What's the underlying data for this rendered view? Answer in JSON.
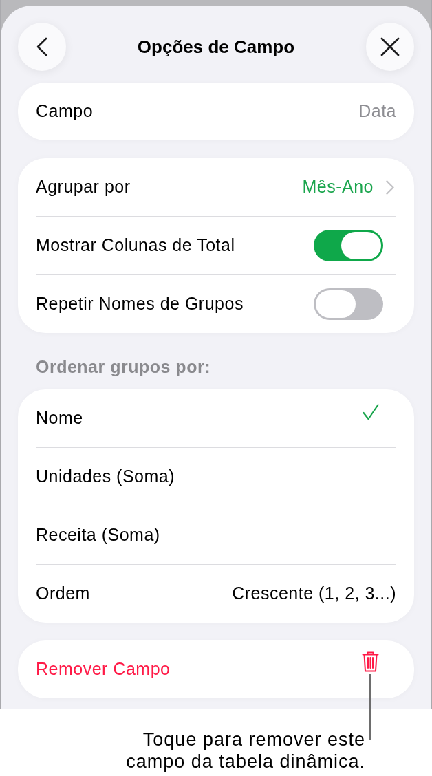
{
  "header": {
    "title": "Opções de Campo"
  },
  "field_row": {
    "label": "Campo",
    "value": "Data"
  },
  "group_settings": [
    {
      "kind": "link",
      "label": "Agrupar por",
      "value": "Mês-Ano"
    },
    {
      "kind": "toggle",
      "label": "Mostrar Colunas de Total",
      "on": true
    },
    {
      "kind": "toggle",
      "label": "Repetir Nomes de Grupos",
      "on": false
    }
  ],
  "sort_section": {
    "header": "Ordenar grupos por:",
    "options": [
      {
        "label": "Nome",
        "selected": true
      },
      {
        "label": "Unidades (Soma)",
        "selected": false
      },
      {
        "label": "Receita (Soma)",
        "selected": false
      }
    ],
    "order": {
      "label": "Ordem",
      "value": "Crescente (1, 2, 3...)"
    }
  },
  "remove": {
    "label": "Remover Campo"
  },
  "callout": {
    "text": "Toque para remover este\ncampo da tabela dinâmica."
  }
}
